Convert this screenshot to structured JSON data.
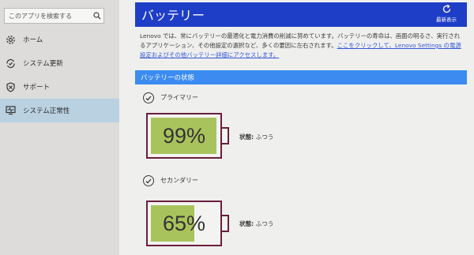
{
  "sidebar": {
    "search_placeholder": "このアプリを検索する",
    "items": [
      {
        "label": "ホーム",
        "icon": "gear-icon"
      },
      {
        "label": "システム更新",
        "icon": "refresh-check-icon"
      },
      {
        "label": "サポート",
        "icon": "shield-icon"
      },
      {
        "label": "システム正常性",
        "icon": "monitor-icon",
        "active": true
      }
    ]
  },
  "header": {
    "title": "バッテリー",
    "refresh_label": "最新表示"
  },
  "description": {
    "text": "Lenovo では、常にバッテリーの最適化と電力消費の削減に努めています。バッテリーの寿命は、画面の明るさ、実行されるアプリケーション、その他設定の選択など、多くの要因に左右されます。",
    "link": "ここをクリックして、Lenovo Settings の電源設定およびその他バッテリー詳細にアクセスします。"
  },
  "section": {
    "title": "バッテリーの状態"
  },
  "batteries": [
    {
      "label": "プライマリー",
      "percent_text": "99%",
      "level": 0.99,
      "status_label": "状態:",
      "status_value": "ふつう"
    },
    {
      "label": "セカンダリー",
      "percent_text": "65%",
      "level": 0.65,
      "status_label": "状態:",
      "status_value": "ふつう"
    }
  ],
  "colors": {
    "header_blue": "#1e3ec7",
    "section_blue": "#3b8bf1",
    "battery_outline": "#6a1e3e",
    "battery_fill": "#a9c35c",
    "active_nav": "#b9d1e0",
    "link": "#3559d6"
  }
}
